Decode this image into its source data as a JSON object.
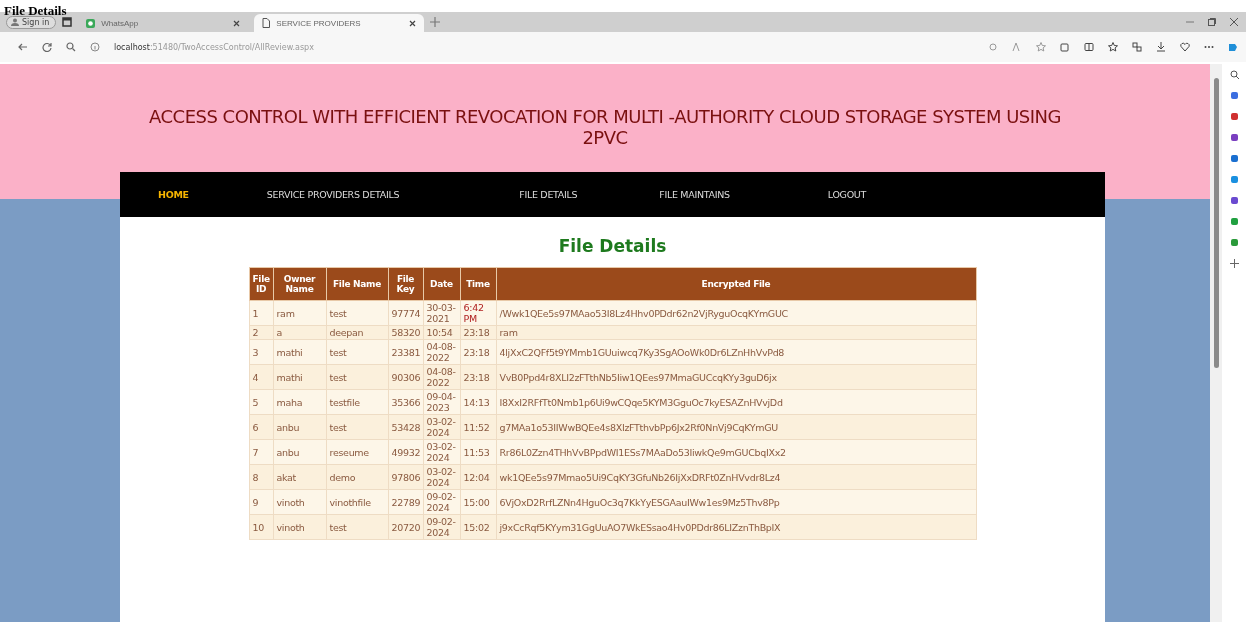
{
  "caption": "File Details",
  "browser": {
    "profile": "Sign in",
    "tabs": [
      {
        "title": "WhatsApp",
        "selected": false
      },
      {
        "title": "SERVICE PROVIDERS",
        "selected": true
      }
    ],
    "url_host": "localhost",
    "url_path": ":51480/TwoAccessControl/AllReview.aspx"
  },
  "site_title": "ACCESS CONTROL WITH EFFICIENT REVOCATION FOR MULTI -AUTHORITY CLOUD STORAGE SYSTEM USING 2PVC",
  "nav": [
    {
      "label": "HOME",
      "selected": true
    },
    {
      "label": "SERVICE PROVIDERS DETAILS",
      "selected": false
    },
    {
      "label": "FILE DETAILS",
      "selected": false
    },
    {
      "label": "FILE MAINTAINS",
      "selected": false
    },
    {
      "label": "LOGOUT",
      "selected": false
    }
  ],
  "heading": "File Details",
  "table": {
    "columns": [
      "File ID",
      "Owner Name",
      "File Name",
      "File Key",
      "Date",
      "Time",
      "Encrypted File"
    ],
    "rows": [
      [
        "1",
        "ram",
        "test",
        "97774",
        "30-03-2021",
        "6:42 PM",
        "/Wwk1QEe5s97MAao53I8Lz4Hhv0PDdr62n2VjRyguOcqKYmGUC"
      ],
      [
        "2",
        "a",
        "deepan",
        "58320",
        "10:54",
        "23:18",
        "ram"
      ],
      [
        "3",
        "mathi",
        "test",
        "23381",
        "04-08-2022",
        "23:18",
        "4ljXxC2QFf5t9YMmb1GUuiwcq7Ky3SgAOoWk0Dr6LZnHhVvPd8"
      ],
      [
        "4",
        "mathi",
        "test",
        "90306",
        "04-08-2022",
        "23:18",
        "VvB0Ppd4r8XLI2zFTthNb5Iiw1QEes97MmaGUCcqKYy3guD6jx"
      ],
      [
        "5",
        "maha",
        "testfile",
        "35366",
        "09-04-2023",
        "14:13",
        "I8XxI2RFfTt0Nmb1p6Ui9wCQqe5KYM3GguOc7kyESAZnHVvjDd"
      ],
      [
        "6",
        "anbu",
        "test",
        "53428",
        "03-02-2024",
        "11:52",
        "g7MAa1o53IIWwBQEe4s8XIzFTthvbPp6Jx2Rf0NnVj9CqKYmGU"
      ],
      [
        "7",
        "anbu",
        "reseume",
        "49932",
        "03-02-2024",
        "11:53",
        "Rr86L0Zzn4THhVvBPpdWI1ESs7MAaDo53IiwkQe9mGUCbqIXx2"
      ],
      [
        "8",
        "akat",
        "demo",
        "97806",
        "03-02-2024",
        "12:04",
        "wk1QEe5s97Mmao5Ui9CqKY3GfuNb26IjXxDRFt0ZnHVvdr8Lz4"
      ],
      [
        "9",
        "vinoth",
        "vinothfile",
        "22789",
        "09-02-2024",
        "15:00",
        "6VjOxD2RrfLZNn4HguOc3q7KkYyESGAauIWw1es9Mz5Thv8Pp"
      ],
      [
        "10",
        "vinoth",
        "test",
        "20720",
        "09-02-2024",
        "15:02",
        "j9xCcRqf5KYym31GgUuAO7WkESsao4Hv0PDdr86LIZznThBpIX"
      ]
    ]
  }
}
